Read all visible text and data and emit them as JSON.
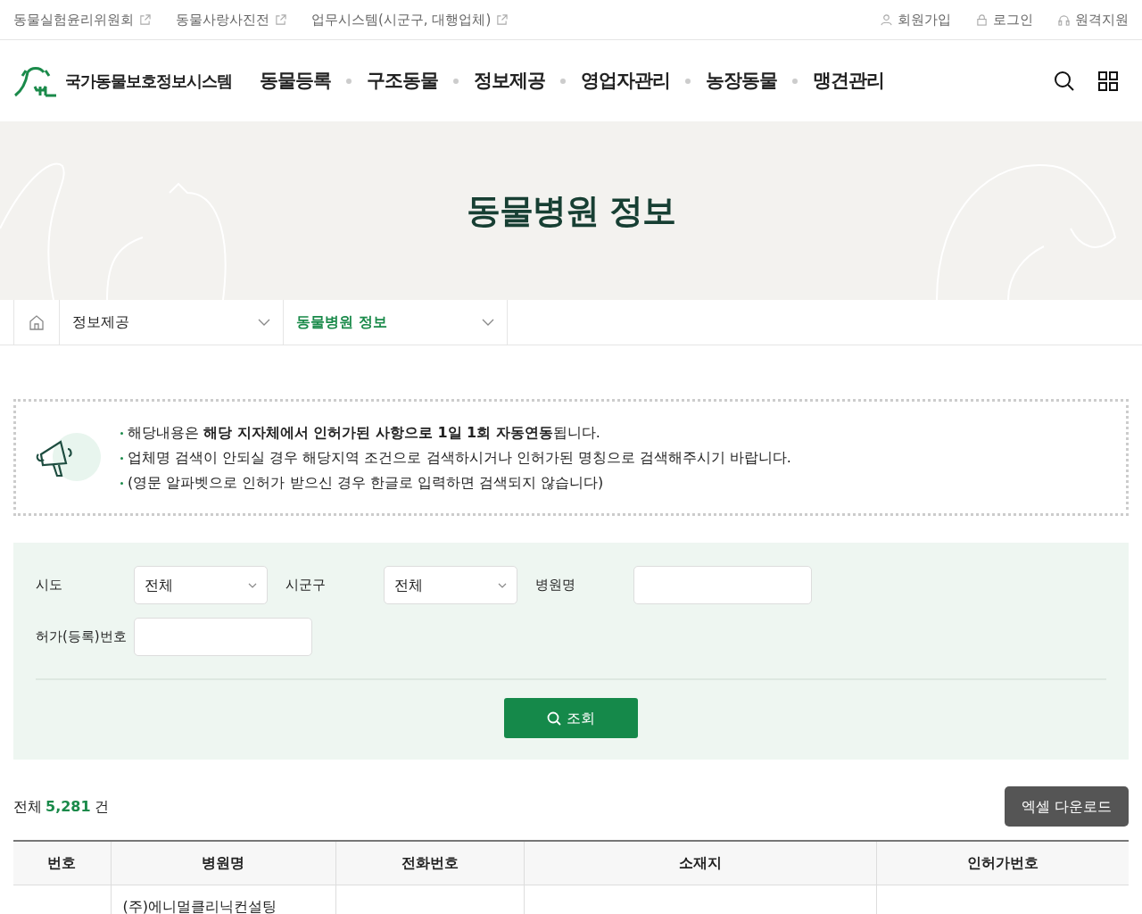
{
  "top_links": [
    {
      "label": "동물실험윤리위원회"
    },
    {
      "label": "동물사랑사진전"
    },
    {
      "label": "업무시스템(시군구, 대행업체)"
    }
  ],
  "user_links": [
    {
      "label": "회원가입",
      "kind": "user"
    },
    {
      "label": "로그인",
      "kind": "lock"
    },
    {
      "label": "원격지원",
      "kind": "headset"
    }
  ],
  "logo": {
    "text": "국가동물보호정보시스템"
  },
  "nav": [
    "동물등록",
    "구조동물",
    "정보제공",
    "영업자관리",
    "농장동물",
    "맹견관리"
  ],
  "page_title": "동물병원 정보",
  "breadcrumb": [
    {
      "label": "정보제공",
      "selected": false
    },
    {
      "label": "동물병원 정보",
      "selected": true
    }
  ],
  "notice": [
    "해당내용은 **해당 지자체에서 인허가된 사항으로 1일 1회 자동연동**됩니다.",
    "업체명 검색이 안되실 경우 해당지역 조건으로 검색하시거나 인허가된 명칭으로 검색해주시기 바랍니다.",
    "(영문 알파벳으로 인허가 받으신 경우 한글로 입력하면 검색되지 않습니다)"
  ],
  "search_form": {
    "fields": [
      {
        "label": "시도",
        "kind": "select",
        "value": "전체"
      },
      {
        "label": "시군구",
        "kind": "select",
        "value": "전체"
      },
      {
        "label": "병원명",
        "kind": "text"
      },
      {
        "label": "허가(등록)번호",
        "kind": "text"
      }
    ],
    "button": "조회"
  },
  "result": {
    "prefix": "전체",
    "count": "5,281",
    "suffix": "건",
    "excel_button": "엑셀 다운로드"
  },
  "table": {
    "columns": [
      "번호",
      "병원명",
      "전화번호",
      "소재지",
      "인허가번호"
    ],
    "rows": [
      [
        "",
        "(주)에니멀클리닉컨설팅",
        "",
        "",
        ""
      ]
    ]
  }
}
